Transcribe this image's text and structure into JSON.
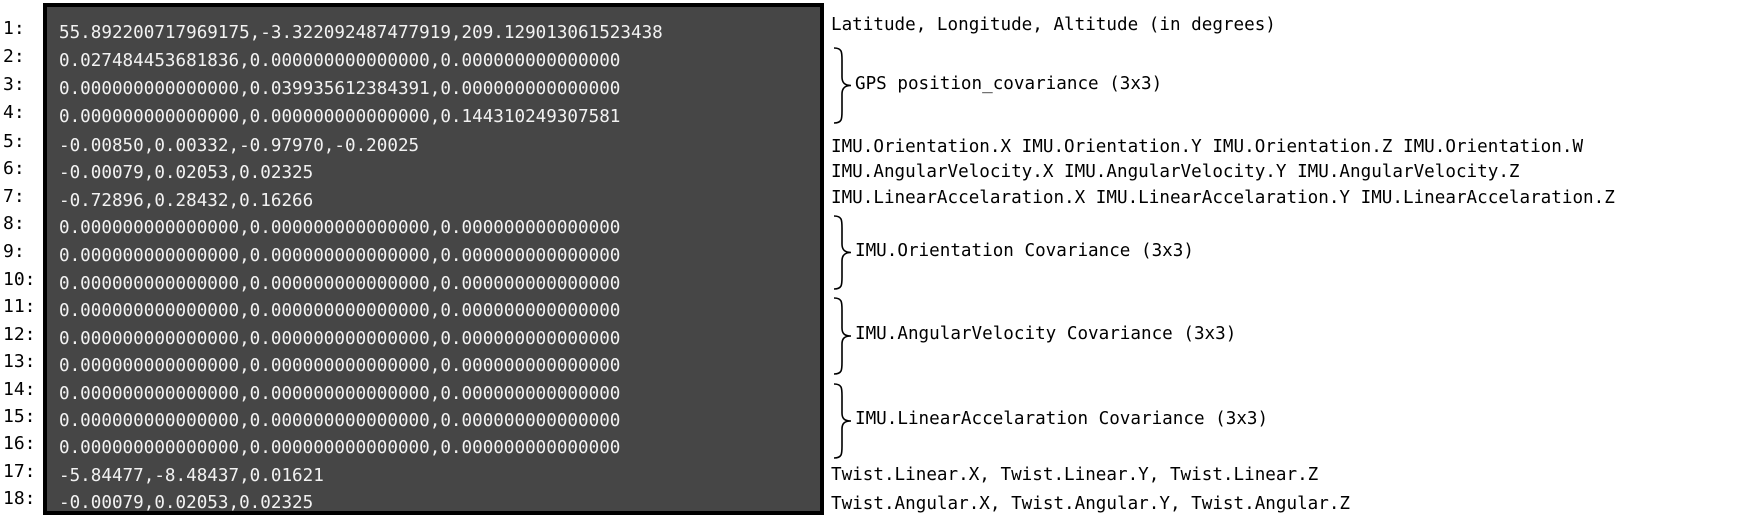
{
  "line_numbers": [
    "1:",
    "2:",
    "3:",
    "4:",
    "5:",
    "6:",
    "7:",
    "8:",
    "9:",
    "10:",
    "11:",
    "12:",
    "13:",
    "14:",
    "15:",
    "16:",
    "17:",
    "18:"
  ],
  "data_lines": [
    "55.892200717969175,-3.322092487477919,209.129013061523438",
    "0.027484453681836,0.000000000000000,0.000000000000000",
    "0.000000000000000,0.039935612384391,0.000000000000000",
    "0.000000000000000,0.000000000000000,0.144310249307581",
    "-0.00850,0.00332,-0.97970,-0.20025",
    "-0.00079,0.02053,0.02325",
    "-0.72896,0.28432,0.16266",
    "0.000000000000000,0.000000000000000,0.000000000000000",
    "0.000000000000000,0.000000000000000,0.000000000000000",
    "0.000000000000000,0.000000000000000,0.000000000000000",
    "0.000000000000000,0.000000000000000,0.000000000000000",
    "0.000000000000000,0.000000000000000,0.000000000000000",
    "0.000000000000000,0.000000000000000,0.000000000000000",
    "0.000000000000000,0.000000000000000,0.000000000000000",
    "0.000000000000000,0.000000000000000,0.000000000000000",
    "0.000000000000000,0.000000000000000,0.000000000000000",
    "-5.84477,-8.48437,0.01621",
    "-0.00079,0.02053,0.02325"
  ],
  "annotations": {
    "lat_lon_alt": "Latitude, Longitude, Altitude (in degrees)",
    "gps_covariance": "GPS position_covariance (3x3)",
    "imu_orientation": "IMU.Orientation.X IMU.Orientation.Y IMU.Orientation.Z IMU.Orientation.W",
    "imu_angular_velocity": "IMU.AngularVelocity.X IMU.AngularVelocity.Y IMU.AngularVelocity.Z",
    "imu_linear_acceleration": "IMU.LinearAccelaration.X IMU.LinearAccelaration.Y IMU.LinearAccelaration.Z",
    "imu_orientation_covariance": "IMU.Orientation Covariance (3x3)",
    "imu_angular_velocity_covariance": "IMU.AngularVelocity Covariance (3x3)",
    "imu_linear_acceleration_covariance": "IMU.LinearAccelaration Covariance (3x3)",
    "twist_linear": "Twist.Linear.X, Twist.Linear.Y, Twist.Linear.Z",
    "twist_angular": "Twist.Angular.X, Twist.Angular.Y, Twist.Angular.Z"
  },
  "colors": {
    "panel_background": "#464646",
    "panel_border": "#000000",
    "panel_text": "#f2f2f2",
    "page_background": "#ffffff",
    "annotation_text": "#000000"
  }
}
